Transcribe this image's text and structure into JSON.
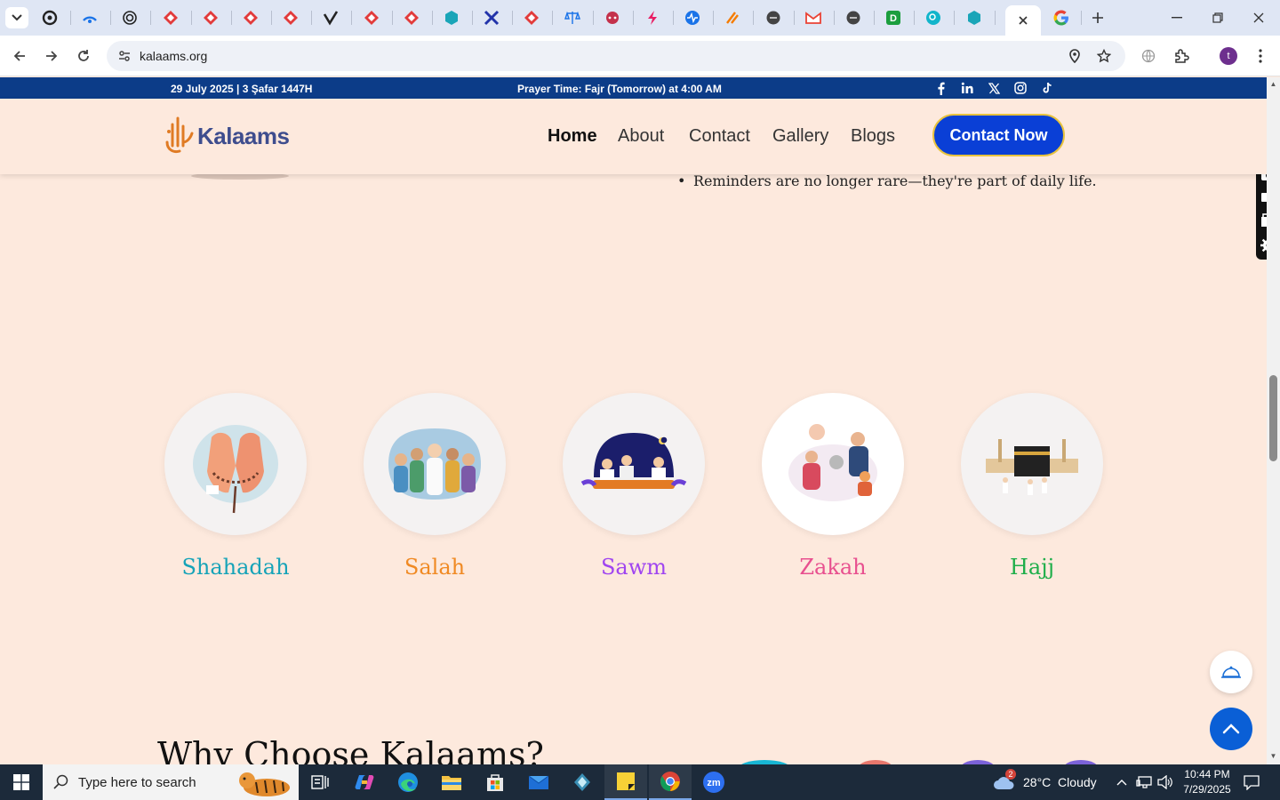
{
  "browser": {
    "address": "kalaams.org",
    "avatar_letter": "t",
    "pinned_tabs": [
      {
        "icon": "threads-icon",
        "color": "#222222"
      },
      {
        "icon": "wifi-app-icon",
        "color": "#1a73e8"
      },
      {
        "icon": "openai-icon",
        "color": "#222222"
      },
      {
        "icon": "diamond-app-icon",
        "color": "#e23b3b"
      },
      {
        "icon": "diamond-app-icon",
        "color": "#e23b3b"
      },
      {
        "icon": "diamond-app-icon",
        "color": "#e23b3b"
      },
      {
        "icon": "diamond-app-icon",
        "color": "#e23b3b"
      },
      {
        "icon": "check-app-icon",
        "color": "#222222"
      },
      {
        "icon": "diamond-app-icon",
        "color": "#e23b3b"
      },
      {
        "icon": "diamond-app-icon",
        "color": "#e23b3b"
      },
      {
        "icon": "hexagon-app-icon",
        "color": "#1aa5b8"
      },
      {
        "icon": "x-app-icon",
        "color": "#2233aa"
      },
      {
        "icon": "diamond-app-icon",
        "color": "#e23b3b"
      },
      {
        "icon": "scales-app-icon",
        "color": "#1a73e8"
      },
      {
        "icon": "dots-app-icon",
        "color": "#c4314b"
      },
      {
        "icon": "bolt-app-icon",
        "color": "#e91e63"
      },
      {
        "icon": "pulse-app-icon",
        "color": "#1a73e8"
      },
      {
        "icon": "slash-app-icon",
        "color": "#f57c00"
      },
      {
        "icon": "globe-icon",
        "color": "#444444"
      },
      {
        "icon": "gmail-icon",
        "color": "#ea4335"
      },
      {
        "icon": "globe-icon",
        "color": "#444444"
      },
      {
        "icon": "d-app-icon",
        "color": "#1b9e3e"
      },
      {
        "icon": "search-app-icon",
        "color": "#12b5cb"
      },
      {
        "icon": "hexagon-app-icon",
        "color": "#1aa5b8"
      }
    ]
  },
  "site": {
    "topbar": {
      "date": "29 July 2025 | 3 Şafar 1447H",
      "prayer_prefix": "Prayer Time: ",
      "prayer_name": "Fajr (Tomorrow)",
      "prayer_suffix": " at 4:00 AM",
      "socials": [
        "facebook-icon",
        "linkedin-icon",
        "x-icon",
        "instagram-icon",
        "tiktok-icon"
      ]
    },
    "logo_text": "Kalaams",
    "nav": [
      "Home",
      "About",
      "Contact",
      "Gallery",
      "Blogs"
    ],
    "cta": "Contact Now",
    "bullet": "Reminders are no longer rare—they're part of daily life.",
    "pillars": [
      {
        "label": "Shahadah",
        "color": "#16a3b8",
        "icon": "praying-hands-icon"
      },
      {
        "label": "Salah",
        "color": "#f08a24",
        "icon": "prayer-group-icon"
      },
      {
        "label": "Sawm",
        "color": "#a045f0",
        "icon": "iftar-icon"
      },
      {
        "label": "Zakah",
        "color": "#e8508f",
        "icon": "charity-icon"
      },
      {
        "label": "Hajj",
        "color": "#1fae4a",
        "icon": "kaaba-icon"
      }
    ],
    "section_title": "Why Choose Kalaams?"
  },
  "taskbar": {
    "search_placeholder": "Type here to search",
    "weather": "28°C  Cloudy",
    "weather_badge": "2",
    "time": "10:44 PM",
    "date": "7/29/2025"
  },
  "colors": {
    "topbar": "#0c3c88",
    "cta": "#0a3fd6",
    "page_bg": "#fde9dd"
  }
}
